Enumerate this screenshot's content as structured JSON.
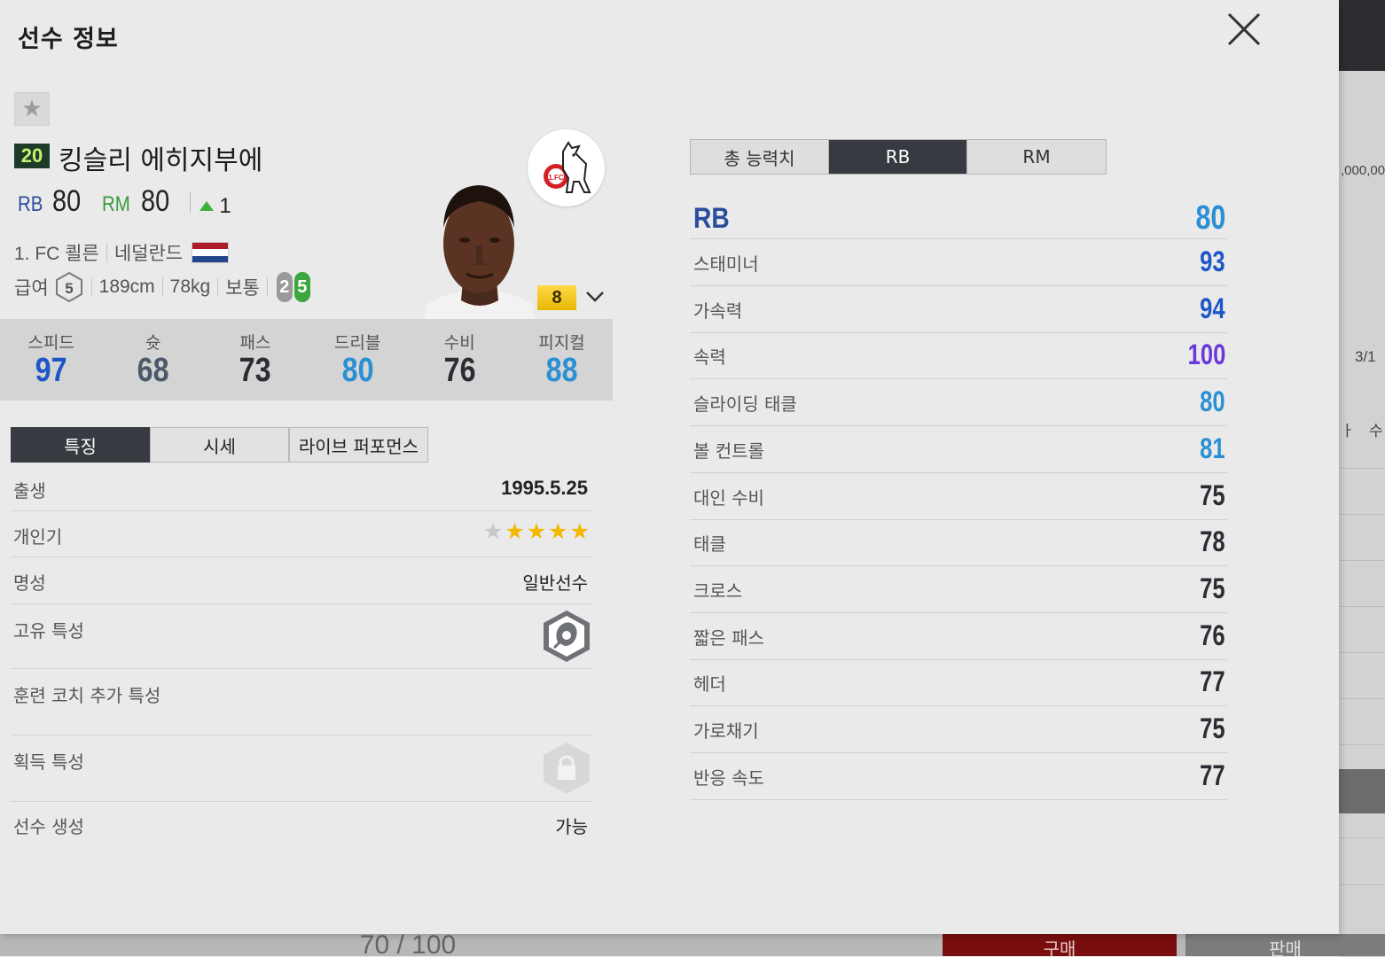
{
  "colors": {
    "pos_rb": "#2a4d9c",
    "pos_rm": "#3a9a3a",
    "stat_blue": "#2b8fd4",
    "stat_darkblue": "#1e56c8",
    "stat_purple": "#6a38d8",
    "stat_dark": "#2a2d33",
    "flag_red": "#ae1c28",
    "flag_white": "#ffffff",
    "flag_blue": "#21468b",
    "star_on": "#f2b800",
    "star_off": "#c8c8c8"
  },
  "background": {
    "right_numbers": ",000,00",
    "page_indicator": "3/1",
    "col_a": "ㅏ",
    "col_b": "수",
    "score": "70 / 100",
    "buy_label": "구매",
    "sell_label": "판매"
  },
  "modal": {
    "title": "선수 정보",
    "close_icon": "close-icon"
  },
  "player": {
    "season_no": "20",
    "name": "킹슬리 에히지부에",
    "positions": [
      {
        "pos": "RB",
        "ovr": "80",
        "color": "#2a4d9c"
      },
      {
        "pos": "RM",
        "ovr": "80",
        "color": "#3a9a3a"
      }
    ],
    "delta": "1",
    "club": "1. FC 쾰른",
    "nation": "네덜란드",
    "salary_label": "급여",
    "salary": "5",
    "height": "189cm",
    "weight": "78kg",
    "body_type": "보통",
    "foot_left": "2",
    "foot_right": "5",
    "enhance_level": "8",
    "club_logo_icon": "fc-koln-logo"
  },
  "stats": [
    {
      "label": "스피드",
      "value": "97",
      "color": "#1e56c8"
    },
    {
      "label": "슛",
      "value": "68",
      "color": "#4b5a6b"
    },
    {
      "label": "패스",
      "value": "73",
      "color": "#2a2d33"
    },
    {
      "label": "드리블",
      "value": "80",
      "color": "#2b8fd4"
    },
    {
      "label": "수비",
      "value": "76",
      "color": "#2a2d33"
    },
    {
      "label": "피지컬",
      "value": "88",
      "color": "#2b8fd4"
    }
  ],
  "left_tabs": [
    "특징",
    "시세",
    "라이브 퍼포먼스"
  ],
  "details": {
    "birth_label": "출생",
    "birth_value": "1995.5.25",
    "skill_label": "개인기",
    "skill_stars": 4,
    "skill_max": 5,
    "fame_label": "명성",
    "fame_value": "일반선수",
    "trait_label": "고유 특성",
    "trait_icon": "trait-glove-icon",
    "coach_label": "훈련 코치 추가 특성",
    "acquired_label": "획득 특성",
    "acquired_icon": "lock-icon",
    "create_label": "선수 생성",
    "create_value": "가능"
  },
  "right_tabs": [
    "총 능력치",
    "RB",
    "RM"
  ],
  "attr_header": {
    "label": "RB",
    "value": "80"
  },
  "attributes": [
    {
      "label": "스태미너",
      "value": "93",
      "color": "#1e56c8"
    },
    {
      "label": "가속력",
      "value": "94",
      "color": "#1e56c8"
    },
    {
      "label": "속력",
      "value": "100",
      "color": "#6a38d8"
    },
    {
      "label": "슬라이딩 태클",
      "value": "80",
      "color": "#2b8fd4"
    },
    {
      "label": "볼 컨트롤",
      "value": "81",
      "color": "#2b8fd4"
    },
    {
      "label": "대인 수비",
      "value": "75",
      "color": "#2a2d33"
    },
    {
      "label": "태클",
      "value": "78",
      "color": "#2a2d33"
    },
    {
      "label": "크로스",
      "value": "75",
      "color": "#2a2d33"
    },
    {
      "label": "짧은 패스",
      "value": "76",
      "color": "#2a2d33"
    },
    {
      "label": "헤더",
      "value": "77",
      "color": "#2a2d33"
    },
    {
      "label": "가로채기",
      "value": "75",
      "color": "#2a2d33"
    },
    {
      "label": "반응 속도",
      "value": "77",
      "color": "#2a2d33"
    }
  ]
}
